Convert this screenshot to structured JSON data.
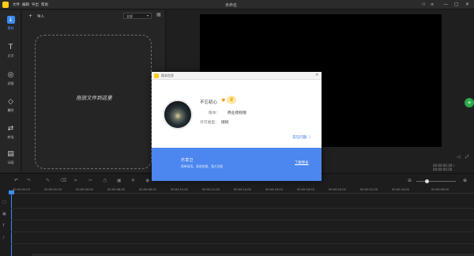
{
  "titlebar": {
    "menus": [
      "文件",
      "编辑",
      "导出",
      "帮助"
    ],
    "title": "未命名",
    "controls": [
      "—",
      "▢",
      "✕"
    ]
  },
  "sidebar": {
    "items": [
      {
        "icon": "import-icon",
        "glyph": "↓",
        "label": "素材"
      },
      {
        "icon": "text-icon",
        "glyph": "T",
        "label": "文字"
      },
      {
        "icon": "filter-icon",
        "glyph": "◎",
        "label": "滤镜"
      },
      {
        "icon": "overlay-icon",
        "glyph": "◇",
        "label": "叠附"
      },
      {
        "icon": "transition-icon",
        "glyph": "⇄",
        "label": "转场"
      },
      {
        "icon": "animation-icon",
        "glyph": "▤",
        "label": "动画"
      }
    ]
  },
  "media": {
    "import_label": "导入",
    "sort_value": "全部",
    "drop_text": "拖放文件到这里"
  },
  "preview": {
    "timecode": "00:00:00.00 / 00:00:00.00"
  },
  "timeline": {
    "ruler": [
      "00:00:00.00",
      "00:00:02.00",
      "00:00:04.00",
      "00:00:06.00",
      "00:00:08.00",
      "00:00:10.00",
      "00:00:12.00",
      "00:00:14.00",
      "00:00:16.00",
      "00:00:18.00",
      "00:00:20.00",
      "00:00:22.00",
      "00:00:24.00",
      "00:00:26.00"
    ]
  },
  "dialog": {
    "title": "版本信息",
    "name": "不忘初心",
    "version_label": "版本：",
    "version_value": "商业授权版",
    "license_label": "许可类型：",
    "license_value": "授权",
    "faq_link": "常见问题",
    "promo_title": "乐享卫",
    "promo_sub": "简单易用，高效剪辑，强大功能",
    "promo_button": "了解更多"
  },
  "colors": {
    "accent": "#4b87ee",
    "crown": "#f5c026",
    "applogo": "#ffcc1a"
  }
}
